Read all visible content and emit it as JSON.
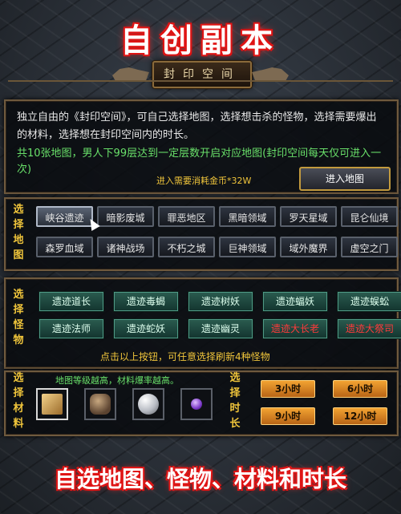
{
  "header": {
    "title": "自创副本",
    "banner": "封印空间"
  },
  "intro": {
    "description": "独立自由的《封印空间》，可自己选择地图，选择想击杀的怪物，选择需要爆出的材料，选择想在封印空间内的时长。",
    "info": "共10张地图，男人下99层达到一定层数开启对应地图(封印空间每天仅可进入一次)",
    "cost": "进入需要消耗金币*32W",
    "enter_button": "进入地图"
  },
  "maps": {
    "label": "选择地图",
    "items": [
      "峡谷遗迹",
      "暗影废城",
      "罪恶地区",
      "黑暗领域",
      "罗天星域",
      "昆仑仙境",
      "森罗血域",
      "诸神战场",
      "不朽之城",
      "巨神领域",
      "域外魔界",
      "虚空之门"
    ],
    "selected_index": 0
  },
  "monsters": {
    "label": "选择怪物",
    "items": [
      {
        "name": "遗迹道长",
        "color": "normal"
      },
      {
        "name": "遗迹毒蝎",
        "color": "normal"
      },
      {
        "name": "遗迹树妖",
        "color": "normal"
      },
      {
        "name": "遗迹蝠妖",
        "color": "normal"
      },
      {
        "name": "遗迹蜈蚣",
        "color": "normal"
      },
      {
        "name": "遗迹法师",
        "color": "normal"
      },
      {
        "name": "遗迹蛇妖",
        "color": "normal"
      },
      {
        "name": "遗迹幽灵",
        "color": "normal"
      },
      {
        "name": "遗迹大长老",
        "color": "boss"
      },
      {
        "name": "遗迹大祭司",
        "color": "boss"
      }
    ],
    "hint": "点击以上按钮，可任意选择刷新4种怪物"
  },
  "materials": {
    "label": "选择材料",
    "hint": "地图等级越高，材料爆率越高。",
    "slots": [
      {
        "icon": "scroll-icon",
        "selected": true
      },
      {
        "icon": "ore-icon",
        "selected": false
      },
      {
        "icon": "pearl-icon",
        "selected": false
      },
      {
        "icon": "purple-gem-icon",
        "selected": false
      }
    ]
  },
  "duration": {
    "label": "选择时长",
    "options": [
      "3小时",
      "6小时",
      "9小时",
      "12小时"
    ]
  },
  "footer": {
    "caption": "自选地图、怪物、材料和时长"
  },
  "colors": {
    "accent_gold": "#f0c53b",
    "info_green": "#69e06a",
    "boss_red": "#ff3a3a",
    "title_red": "#e01515"
  }
}
